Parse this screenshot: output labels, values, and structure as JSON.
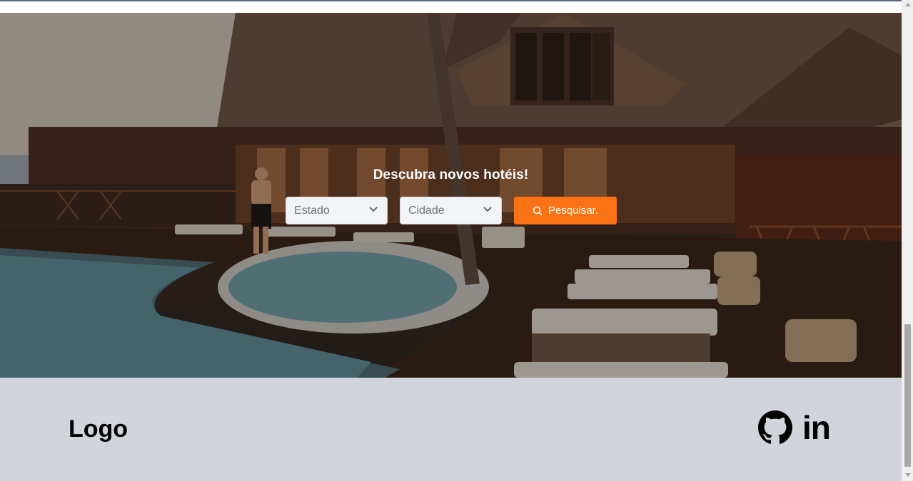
{
  "hero": {
    "title": "Descubra novos hotéis!",
    "state_select": {
      "placeholder": "Estado"
    },
    "city_select": {
      "placeholder": "Cidade"
    },
    "search_button": {
      "label": "Pesquisar.",
      "color": "#f97316"
    }
  },
  "footer": {
    "logo_text": "Logo",
    "social": {
      "github_icon": "github-icon",
      "linkedin_label": "in"
    },
    "background": "#d1d5db"
  }
}
